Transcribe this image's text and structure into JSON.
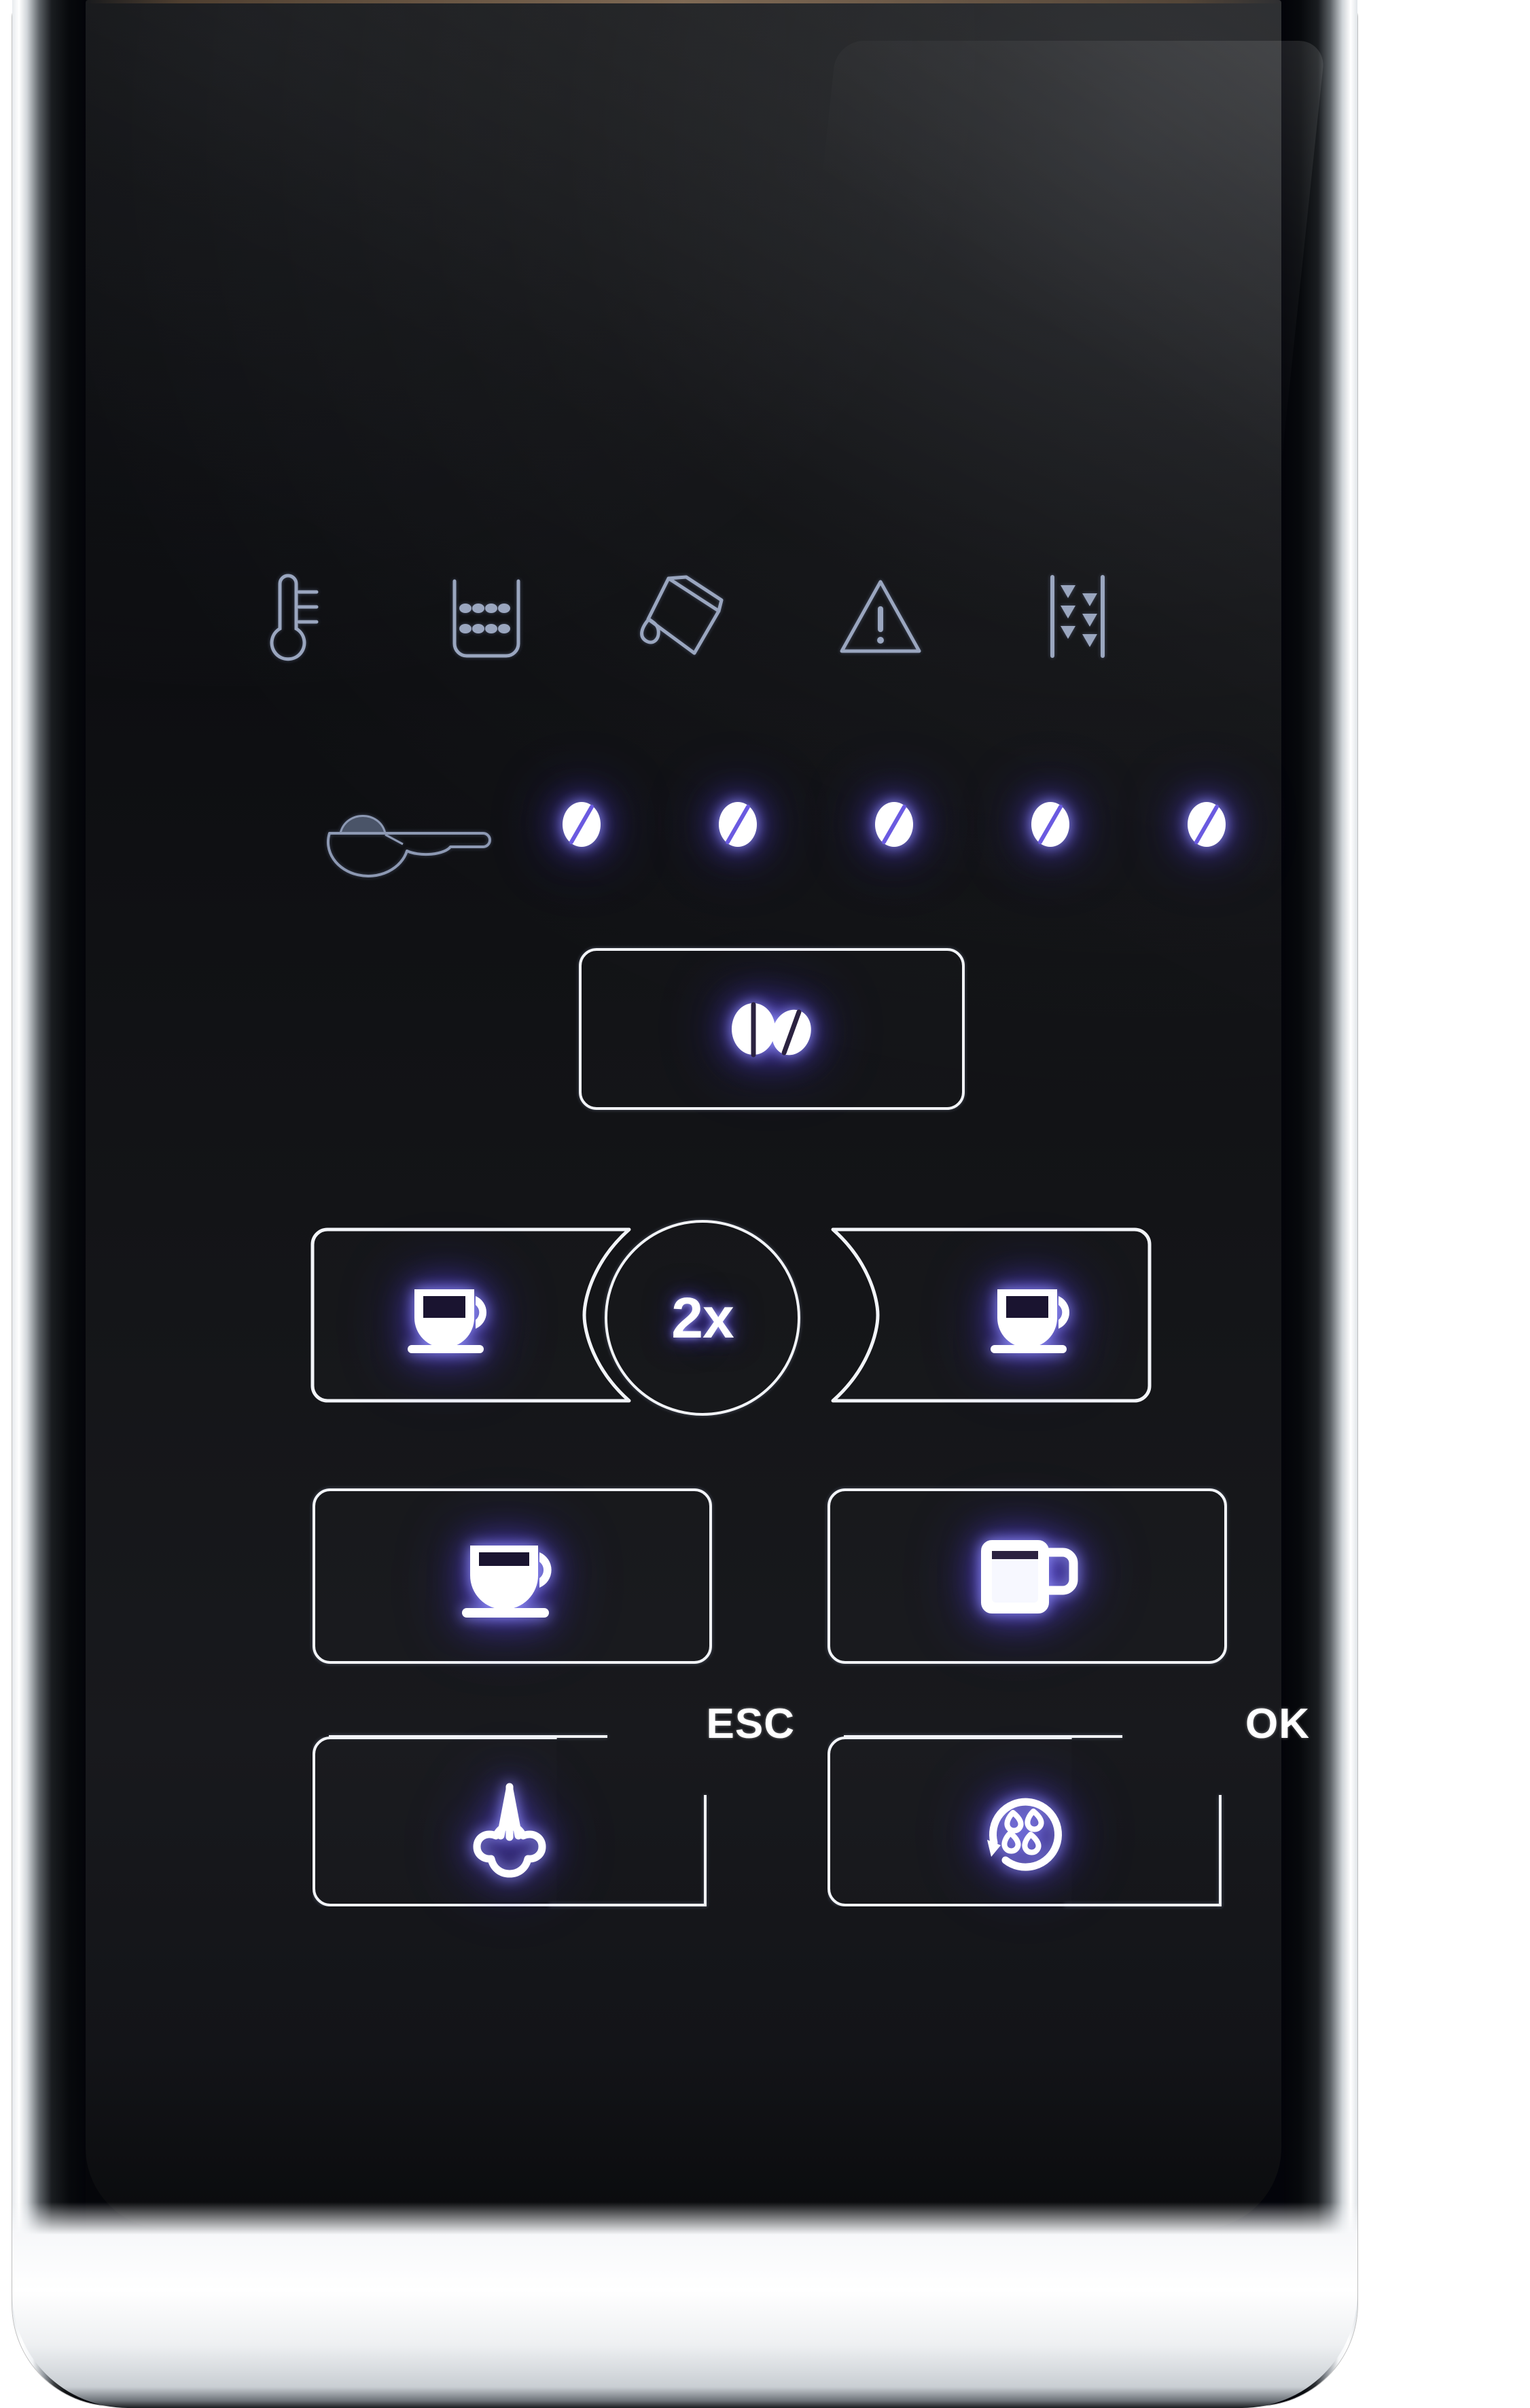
{
  "device": {
    "name": "Espresso machine control panel",
    "panel_color": "#0c0d10",
    "bezel_color": "#ffffff",
    "led_color": "#ffffff",
    "led_glow_color": "#5a46e6"
  },
  "status_indicators": {
    "items": [
      {
        "id": "temperature",
        "icon": "thermometer-icon",
        "label": "Temperature",
        "lit": false
      },
      {
        "id": "grounds_container",
        "icon": "grounds-container-icon",
        "label": "Grounds container",
        "lit": false
      },
      {
        "id": "water_tank",
        "icon": "water-tank-icon",
        "label": "Water tank",
        "lit": false
      },
      {
        "id": "warning",
        "icon": "warning-triangle-icon",
        "label": "Warning",
        "lit": false
      },
      {
        "id": "grinder",
        "icon": "grinder-icon",
        "label": "Grinder",
        "lit": false
      }
    ]
  },
  "strength_row": {
    "scoop": {
      "icon": "ground-coffee-scoop-icon",
      "label": "Pre-ground coffee",
      "lit": false
    },
    "beans": {
      "label": "Coffee strength",
      "total": 5,
      "lit_count": 5,
      "leds": [
        {
          "index": 1,
          "lit": true
        },
        {
          "index": 2,
          "lit": true
        },
        {
          "index": 3,
          "lit": true
        },
        {
          "index": 4,
          "lit": true
        },
        {
          "index": 5,
          "lit": true
        }
      ]
    }
  },
  "bean_select_button": {
    "icon": "two-beans-icon",
    "label": "Bean strength select",
    "lit": true
  },
  "beverage_row": {
    "left": {
      "icon": "espresso-cup-icon",
      "label": "Espresso",
      "lit": true
    },
    "center": {
      "icon": "double-shot-icon",
      "label": "2x",
      "lit": true
    },
    "right": {
      "icon": "espresso-cup-icon",
      "label": "Espresso right",
      "lit": true
    }
  },
  "beverage_row_2": {
    "left": {
      "icon": "coffee-cup-icon",
      "label": "Coffee",
      "lit": true
    },
    "right": {
      "icon": "coffee-mug-icon",
      "label": "Mug",
      "lit": true
    }
  },
  "control_row": {
    "left": {
      "icon": "steam-icon",
      "label": "ESC",
      "lit": true
    },
    "right": {
      "icon": "cleaning-icon",
      "label": "OK",
      "lit": true
    }
  }
}
